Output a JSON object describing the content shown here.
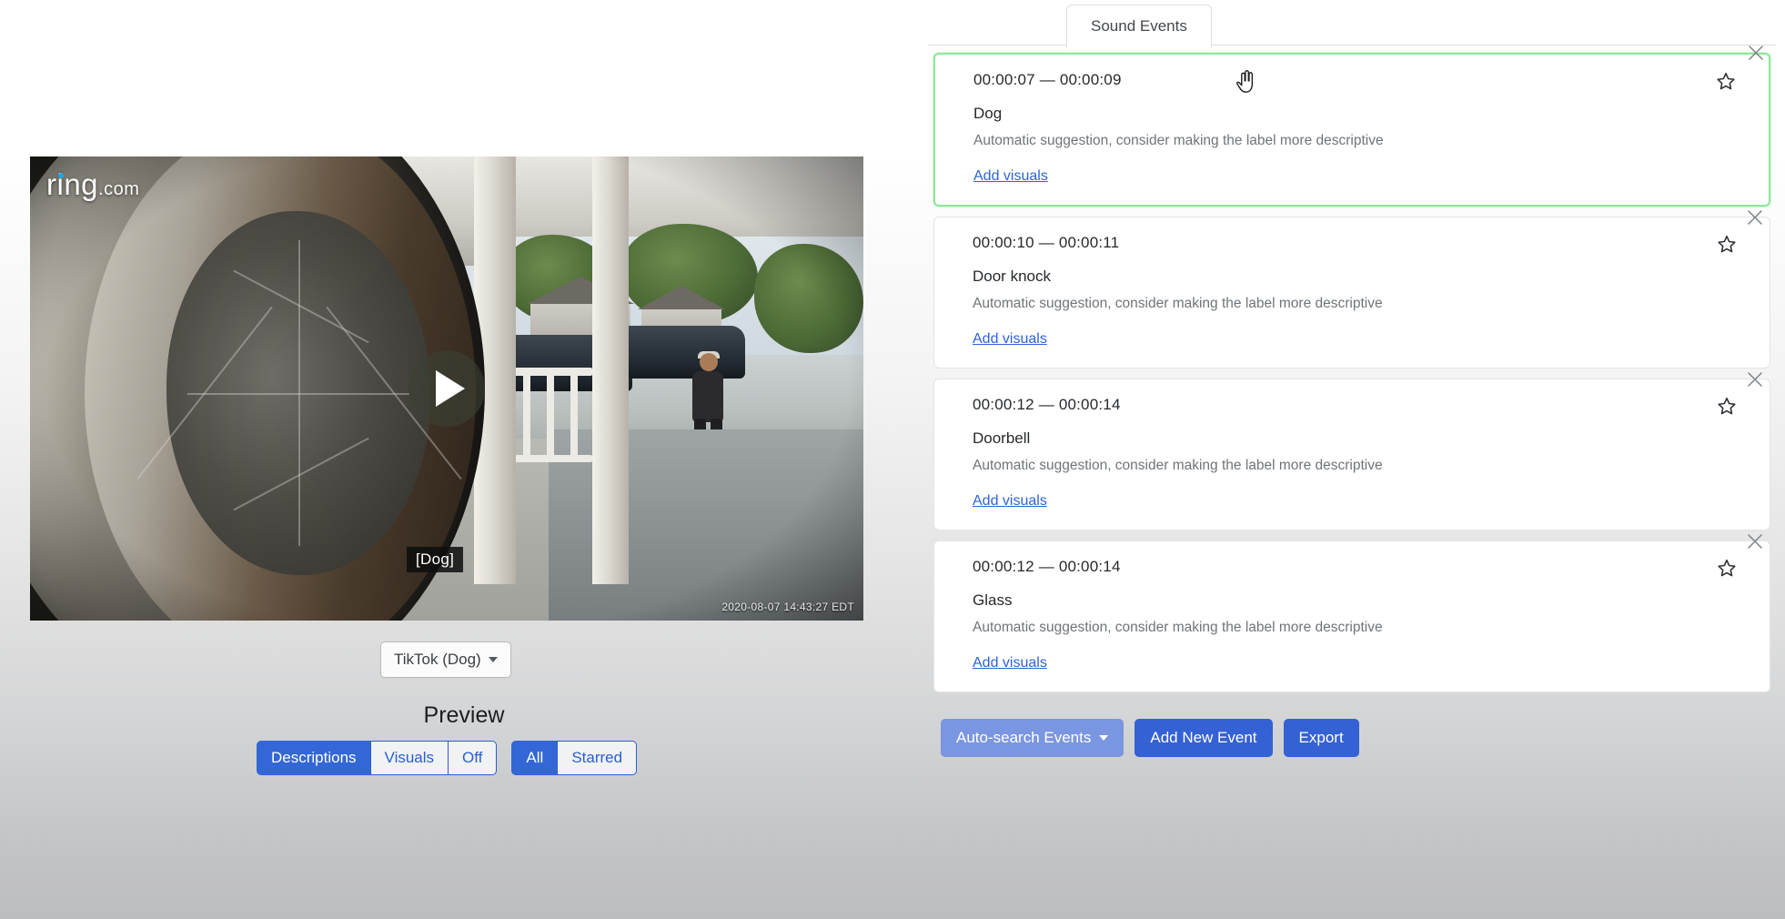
{
  "video": {
    "watermark": "ring",
    "watermark_suffix": ".com",
    "caption": "[Dog]",
    "timestamp_overlay": "2020-08-07 14:43:27 EDT",
    "play_icon": "play-icon"
  },
  "clip_selector": {
    "label": "TikTok (Dog)",
    "caret_icon": "caret-down-icon"
  },
  "preview": {
    "title": "Preview",
    "display_mode_group": [
      {
        "label": "Descriptions",
        "active": true
      },
      {
        "label": "Visuals",
        "active": false
      },
      {
        "label": "Off",
        "active": false
      }
    ],
    "filter_group": [
      {
        "label": "All",
        "active": true
      },
      {
        "label": "Starred",
        "active": false
      }
    ]
  },
  "tabs": [
    {
      "label": "Sound Events",
      "active": true
    }
  ],
  "events": [
    {
      "time_start": "00:00:07",
      "time_sep": "—",
      "time_end": "00:00:09",
      "time_range": "00:00:07 — 00:00:09",
      "label": "Dog",
      "hint": "Automatic suggestion, consider making the label more descriptive",
      "add_visuals": "Add visuals",
      "selected": true,
      "star_icon": "star-outline-icon",
      "close_icon": "close-icon"
    },
    {
      "time_start": "00:00:10",
      "time_sep": "—",
      "time_end": "00:00:11",
      "time_range": "00:00:10 — 00:00:11",
      "label": "Door knock",
      "hint": "Automatic suggestion, consider making the label more descriptive",
      "add_visuals": "Add visuals",
      "selected": false,
      "star_icon": "star-outline-icon",
      "close_icon": "close-icon"
    },
    {
      "time_start": "00:00:12",
      "time_sep": "—",
      "time_end": "00:00:14",
      "time_range": "00:00:12 — 00:00:14",
      "label": "Doorbell",
      "hint": "Automatic suggestion, consider making the label more descriptive",
      "add_visuals": "Add visuals",
      "selected": false,
      "star_icon": "star-outline-icon",
      "close_icon": "close-icon"
    },
    {
      "time_start": "00:00:12",
      "time_sep": "—",
      "time_end": "00:00:14",
      "time_range": "00:00:12 — 00:00:14",
      "label": "Glass",
      "hint": "Automatic suggestion, consider making the label more descriptive",
      "add_visuals": "Add visuals",
      "selected": false,
      "star_icon": "star-outline-icon",
      "close_icon": "close-icon"
    }
  ],
  "actions": {
    "auto_search": "Auto-search Events",
    "add_new_event": "Add New Event",
    "export": "Export"
  },
  "colors": {
    "accent_blue": "#3461d4",
    "muted_blue": "#7b96e0",
    "link_blue": "#2f62d8",
    "selected_green": "#8fe79b",
    "text_dark": "#26292c",
    "text_muted": "#6f7479"
  },
  "cursor": {
    "type": "pointer-hand-cursor"
  }
}
